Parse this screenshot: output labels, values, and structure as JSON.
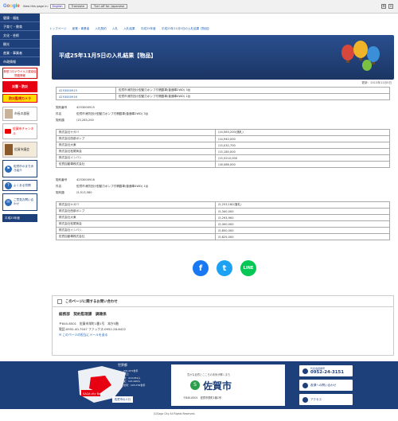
{
  "translate_bar": {
    "logo": "Google",
    "view_text": "View this page in:",
    "language": "English",
    "translate_label": "Translate",
    "turn_off_label": "Turn off for: Japanese"
  },
  "sidebar": {
    "nav": [
      "健康・福祉",
      "子育て・教育",
      "文化・芸術",
      "観光",
      "産業・事業者",
      "市政情報"
    ],
    "boxes": {
      "disaster_head": "新型コロナウイルス感染症関連情報",
      "emergency": "災害・防災",
      "camera": "防災監視カメラ",
      "mayor": "市長の部屋",
      "youtube": "佐賀市チャンネル",
      "assembly": "佐賀市議会",
      "town": "佐賀市のまち歩き紹介",
      "faq": "よくある質問",
      "opinion": "ご意見お問い合わせ"
    },
    "date_label": "平成25年度"
  },
  "breadcrumb": [
    "トップページ",
    "産業・事業者",
    "入札契約",
    "入札",
    "入札結果",
    "平成25年度",
    "平成25年11月5日の入札結果【物品】"
  ],
  "page_title": "平成25年11月5日の入札結果【物品】",
  "updated": "更新：2013年11月5日",
  "lots": [
    {
      "no": "4253000915",
      "name": "佐賀市消防団小型動力ポンプ付積載車(普通車2WD) 3台"
    },
    {
      "no": "4253000916",
      "name": "佐賀市消防団小型動力ポンプ付積載車(普通車4WD) 1台"
    }
  ],
  "contract1": {
    "no_label": "契約番号",
    "no": "4253000915",
    "item_label": "件名",
    "item": "佐賀市消防団小型動力ポンプ付積載車(普通車2WD) 3台",
    "amount_label": "契約額",
    "amount": "\\15,283,200",
    "bids": [
      {
        "company": "株式会社ヤガバ",
        "price": "\\14,563,200(落札)"
      },
      {
        "company": "株式会社西部ポンプ",
        "price": "\\14,940,000"
      },
      {
        "company": "株式会社大東",
        "price": "\\15,032,700"
      },
      {
        "company": "株式会社松尾商会",
        "price": "\\15,180,000"
      },
      {
        "company": "株式会社イシバシ",
        "price": "\\15,5210,000"
      },
      {
        "company": "佐賀自動車株式会社",
        "price": "\\16,086,000"
      }
    ]
  },
  "contract2": {
    "no_label": "契約番号",
    "no": "4253000916",
    "item_label": "件名",
    "item": "佐賀市消防団小型動力ポンプ付積載車(普通車4WD) 1台",
    "amount_label": "契約額",
    "amount": "\\5,513,580",
    "bids": [
      {
        "company": "株式会社ヤガバ",
        "price": "\\5,253,180(落札)"
      },
      {
        "company": "株式会社西部ポンプ",
        "price": "\\5,340,000"
      },
      {
        "company": "株式会社大東",
        "price": "\\5,293,900"
      },
      {
        "company": "株式会社松尾商会",
        "price": "\\5,400,000"
      },
      {
        "company": "株式会社イシバシ",
        "price": "\\5,850,000"
      },
      {
        "company": "佐賀自動車株式会社",
        "price": "\\5,825,000"
      }
    ]
  },
  "social": {
    "facebook": "f",
    "twitter": "t",
    "line": "LINE"
  },
  "inquiry": {
    "heading": "このページに関するお問い合わせ",
    "dept": "総務部　契約監理課　調達係",
    "address": "〒840-8501　佐賀市栄町1番1号　本庁5階",
    "phone": "電話:0952-40-7047 ファックス:0952-26-6422",
    "mail_link": "このページの担当にメールを送る"
  },
  "footer_links": [
    "ホームページの考え方",
    "ウェブアクセシビリティ",
    "リンク集",
    "市のプロフィール"
  ],
  "footer": {
    "map_title": "世界都",
    "stats": [
      "231,971世帯",
      "人口：",
      "男：110,051人",
      "女：121,920人",
      "世帯：103,754世帯"
    ],
    "saga_btn": "佐賀市の人口",
    "map_caption": "SAGA city Board",
    "tagline": "豊かな自然とこころの未来が輝くまち",
    "city_name": "佐賀市",
    "city_address": "〒840-8501　佐賀市栄町1番1号",
    "tel_label": "代表電話番号",
    "tel": "0952-24-3151",
    "access_label": "各課への問い合わせ",
    "map_label": "アクセス"
  },
  "copyright": "(C)Saga City All Rights Reserved."
}
